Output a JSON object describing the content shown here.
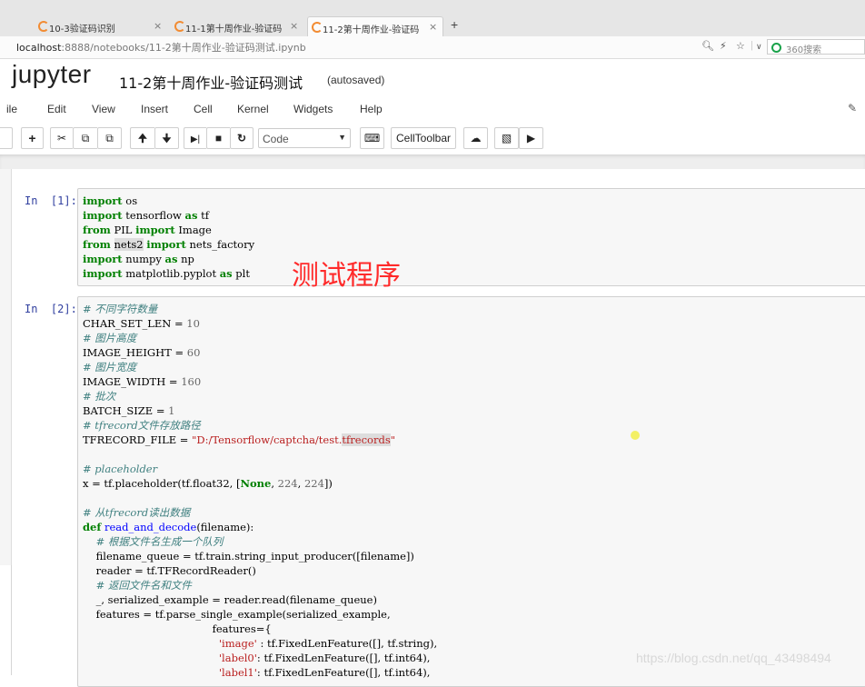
{
  "browser": {
    "tabs": [
      {
        "label": "10-3验证码识别",
        "close": "×"
      },
      {
        "label": "11-1第十周作业-验证码",
        "close": "×"
      },
      {
        "label": "11-2第十周作业-验证码",
        "close": "×"
      }
    ],
    "new_tab": "+",
    "url_host": "localhost",
    "url_rest": ":8888/notebooks/11-2第十周作业-验证码测试.ipynb",
    "search_placeholder": "360搜索"
  },
  "jupyter": {
    "logo_text": "jupyter",
    "notebook_title": "11-2第十周作业-验证码测试",
    "save_status": "(autosaved)",
    "menu": [
      "ile",
      "Edit",
      "View",
      "Insert",
      "Cell",
      "Kernel",
      "Widgets",
      "Help"
    ],
    "cell_type": "Code",
    "celltoolbar_label": "CellToolbar"
  },
  "cells": [
    {
      "prompt": "In  [1]:",
      "code": [
        "import os",
        "import tensorflow as tf",
        "from PIL import Image",
        "from nets2 import nets_factory",
        "import numpy as np",
        "import matplotlib.pyplot as plt"
      ]
    },
    {
      "prompt": "In  [2]:",
      "code": [
        "# 不同字符数量",
        "CHAR_SET_LEN = 10",
        "# 图片高度",
        "IMAGE_HEIGHT = 60",
        "# 图片宽度",
        "IMAGE_WIDTH = 160",
        "# 批次",
        "BATCH_SIZE = 1",
        "# tfrecord文件存放路径",
        "TFRECORD_FILE = \"D:/Tensorflow/captcha/test.tfrecords\"",
        "",
        "# placeholder",
        "x = tf.placeholder(tf.float32, [None, 224, 224])",
        "",
        "# 从tfrecord读出数据",
        "def read_and_decode(filename):",
        "    # 根据文件名生成一个队列",
        "    filename_queue = tf.train.string_input_producer([filename])",
        "    reader = tf.TFRecordReader()",
        "    # 返回文件名和文件",
        "    _, serialized_example = reader.read(filename_queue)",
        "    features = tf.parse_single_example(serialized_example,",
        "                                       features={",
        "                                         'image' : tf.FixedLenFeature([], tf.string),",
        "                                         'label0': tf.FixedLenFeature([], tf.int64),",
        "                                         'label1': tf.FixedLenFeature([], tf.int64),"
      ]
    }
  ],
  "annotation": "测试程序",
  "watermark": "https://blog.csdn.net/qq_43498494"
}
